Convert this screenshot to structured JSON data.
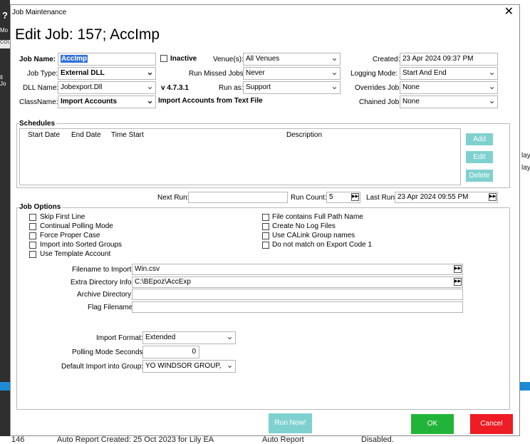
{
  "background": {
    "left_labels": [
      "Mo",
      "COU",
      "it Jo"
    ],
    "right_labels": [
      "lay",
      "lay"
    ],
    "bottom_row": {
      "num": "146",
      "text1": "Auto Report Created: 25 Oct 2023 for Lily EA",
      "text2": "Auto Report",
      "text3": "Disabled."
    }
  },
  "dialog": {
    "title": "Job Maintenance",
    "close_icon": "close-icon",
    "heading": "Edit Job: 157; AccImp"
  },
  "form": {
    "job_name_label": "Job Name:",
    "job_name_value": "AccImp",
    "inactive_label": "Inactive",
    "venues_label": "Venue(s):",
    "venues_value": "All Venues",
    "created_label": "Created:",
    "created_value": "23 Apr 2024 09:37 PM",
    "job_type_label": "Job Type:",
    "job_type_value": "External DLL",
    "run_missed_label": "Run Missed Jobs:",
    "run_missed_value": "Never",
    "logging_label": "Logging Mode:",
    "logging_value": "Start And End",
    "dll_name_label": "DLL Name:",
    "dll_name_value": "Jobexport.Dll",
    "version": "v 4.7.3.1",
    "run_as_label": "Run as:",
    "run_as_value": "Support",
    "overrides_label": "Overrides Job:",
    "overrides_value": "None",
    "classname_label": "ClassName:",
    "classname_value": "Import Accounts",
    "class_description": "Import Accounts from Text File",
    "chained_label": "Chained Job:",
    "chained_value": "None"
  },
  "schedules": {
    "title": "Schedules",
    "columns": [
      "Start Date",
      "End Date",
      "Time Start",
      "Description"
    ],
    "add": "Add",
    "edit": "Edit",
    "delete": "Delete"
  },
  "run_info": {
    "next_run_label": "Next Run:",
    "next_run_value": "",
    "run_count_label": "Run Count:",
    "run_count_value": "5",
    "last_run_label": "Last Run:",
    "last_run_value": "23 Apr 2024 09:55 PM"
  },
  "job_options": {
    "title": "Job Options",
    "left_checks": [
      "Skip First Line",
      "Continual Polling Mode",
      "Force Proper Case",
      "Import into Sorted Groups",
      "Use Template Account"
    ],
    "right_checks": [
      "File contains Full Path Name",
      "Create No Log Files",
      "Use CALink Group names",
      "Do not match on Export Code 1"
    ],
    "filename_label": "Filename to Import:",
    "filename_value": "Win.csv",
    "extra_dir_label": "Extra Directory Info:",
    "extra_dir_value": "C:\\BEpoz\\AccExp",
    "archive_label": "Archive Directory:",
    "archive_value": "",
    "flag_label": "Flag Filename:",
    "flag_value": "",
    "import_format_label": "Import Format:",
    "import_format_value": "Extended",
    "polling_label": "Polling Mode Seconds:",
    "polling_value": "0",
    "default_group_label": "Default Import into Group:",
    "default_group_value": "YO WINDSOR GROUP,"
  },
  "footer": {
    "run_now": "Run Now!",
    "ok": "OK",
    "cancel": "Cancel"
  },
  "colors": {
    "accent_teal": "#7fd1cf",
    "ok_green": "#22b43a",
    "cancel_red": "#ee1c24",
    "selection_blue": "#3170d8"
  }
}
